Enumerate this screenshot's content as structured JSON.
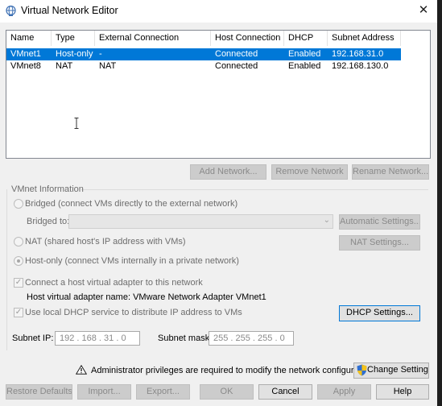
{
  "window": {
    "title": "Virtual Network Editor",
    "close_glyph": "✕",
    "icon": "network-globe-icon"
  },
  "network_table": {
    "columns": [
      "Name",
      "Type",
      "External Connection",
      "Host Connection",
      "DHCP",
      "Subnet Address"
    ],
    "rows": [
      [
        "VMnet1",
        "Host-only",
        "-",
        "Connected",
        "Enabled",
        "192.168.31.0"
      ],
      [
        "VMnet8",
        "NAT",
        "NAT",
        "Connected",
        "Enabled",
        "192.168.130.0"
      ]
    ],
    "selected_row": 0
  },
  "network_buttons": {
    "add": "Add Network...",
    "remove": "Remove Network",
    "rename": "Rename Network..."
  },
  "vmnet_info": {
    "title": "VMnet Information",
    "bridged_label": "Bridged (connect VMs directly to the external network)",
    "bridged_to_label": "Bridged to:",
    "bridged_to_value": "",
    "automatic_settings": "Automatic Settings...",
    "nat_label": "NAT (shared host's IP address with VMs)",
    "nat_settings": "NAT Settings...",
    "hostonly_label": "Host-only (connect VMs internally in a private network)",
    "selected_mode": "Host-only",
    "connect_adapter_label": "Connect a host virtual adapter to this network",
    "connect_adapter_checked": true,
    "adapter_name_label": "Host virtual adapter name: VMware Network Adapter VMnet1",
    "dhcp_label": "Use local DHCP service to distribute IP address to VMs",
    "dhcp_checked": true,
    "dhcp_settings": "DHCP Settings...",
    "subnet_ip_label": "Subnet IP:",
    "subnet_ip_value": "192 . 168 .  31  .  0",
    "subnet_mask_label": "Subnet mask:",
    "subnet_mask_value": "255 . 255 . 255 .  0"
  },
  "admin_notice": {
    "text": "Administrator privileges are required to modify the network configuration.",
    "change_settings": "Change Settings"
  },
  "footer_buttons": {
    "restore": "Restore Defaults",
    "import": "Import...",
    "export": "Export...",
    "ok": "OK",
    "cancel": "Cancel",
    "apply": "Apply",
    "help": "Help"
  },
  "colors": {
    "selection": "#0078d7",
    "window_bg": "#f0f0f0",
    "warning": "#1a1a1a"
  }
}
